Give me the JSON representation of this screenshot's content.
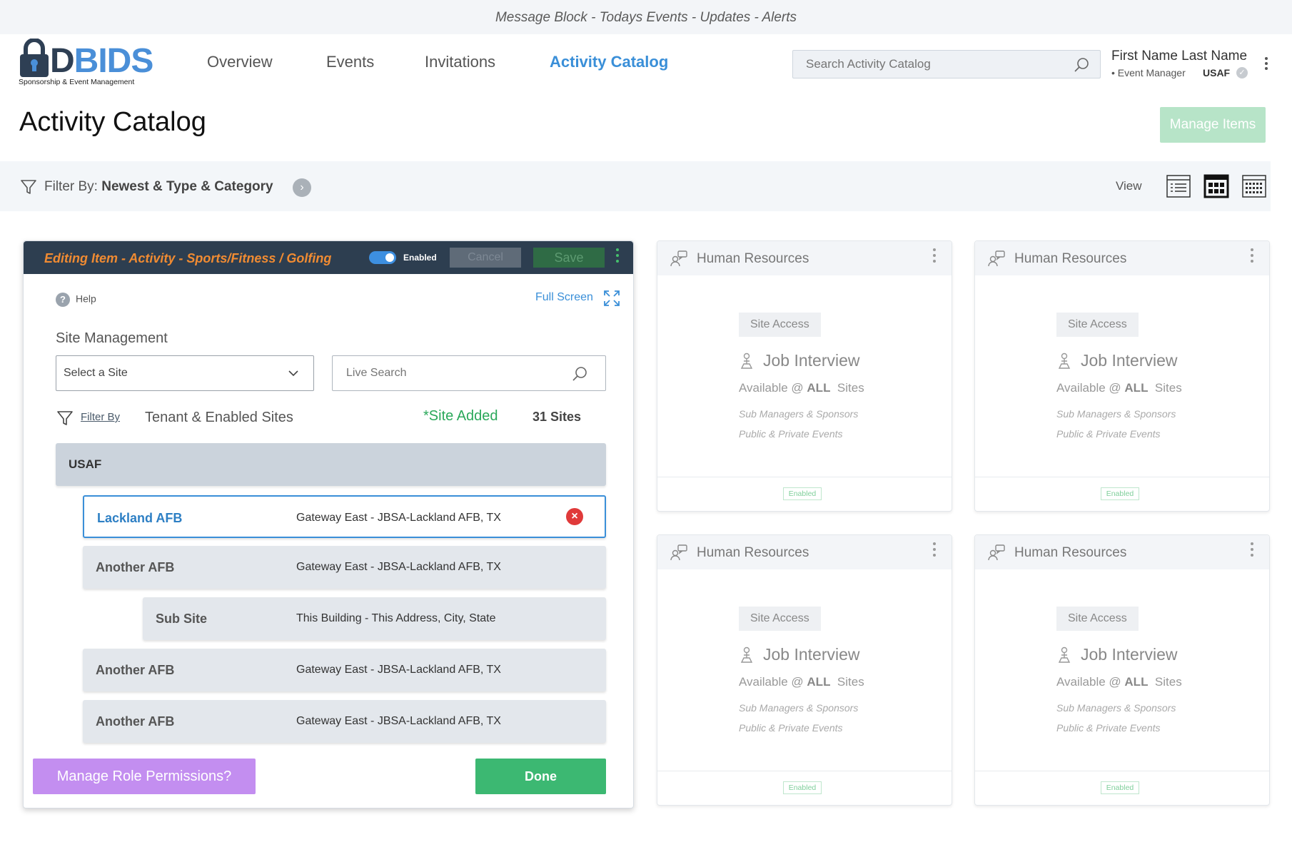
{
  "message_bar": "Message Block - Todays Events - Updates - Alerts",
  "logo": {
    "prefix": "D",
    "brand": "BIDS",
    "tagline": "Sponsorship & Event Management"
  },
  "nav": [
    {
      "label": "Overview",
      "active": false
    },
    {
      "label": "Events",
      "active": false
    },
    {
      "label": "Invitations",
      "active": false
    },
    {
      "label": "Activity Catalog",
      "active": true
    }
  ],
  "search": {
    "placeholder": "Search Activity Catalog"
  },
  "user": {
    "name": "First Name Last Name",
    "role": "• Event Manager",
    "org": "USAF"
  },
  "page_title": "Activity Catalog",
  "manage_items_label": "Manage Items",
  "filter": {
    "label": "Filter By:",
    "value": "Newest & Type & Category"
  },
  "view_label": "View",
  "editor": {
    "title": "Editing Item - Activity - Sports/Fitness / Golfing",
    "toggle_label": "Enabled",
    "enabled": true,
    "cancel_label": "Cancel",
    "save_label": "Save",
    "help_label": "Help",
    "fullscreen_label": "Full Screen",
    "section_title": "Site Management",
    "select_site": "Select a Site",
    "live_search_placeholder": "Live Search",
    "filter_by_label": "Filter By",
    "filter_value": "Tenant & Enabled Sites",
    "site_added": "*Site Added",
    "site_count": "31 Sites",
    "group": "USAF",
    "sites": [
      {
        "name": "Lackland AFB",
        "address": "Gateway East - JBSA-Lackland AFB, TX",
        "selected": true
      },
      {
        "name": "Another  AFB",
        "address": "Gateway East - JBSA-Lackland AFB, TX",
        "selected": false
      },
      {
        "name": "Sub Site",
        "address": "This Building - This Address, City, State",
        "selected": false
      },
      {
        "name": "Another  AFB",
        "address": "Gateway East - JBSA-Lackland AFB, TX",
        "selected": false
      },
      {
        "name": "Another  AFB",
        "address": "Gateway East - JBSA-Lackland AFB, TX",
        "selected": false
      }
    ],
    "role_permissions_label": "Manage Role Permissions?",
    "done_label": "Done"
  },
  "cards": [
    {
      "title": "Human Resources",
      "badge": "Site Access",
      "job": "Job Interview",
      "avail_pre": "Available @",
      "avail_bold": "ALL",
      "avail_post": "Sites",
      "sub1": "Sub Managers & Sponsors",
      "sub2": "Public & Private Events",
      "status": "Enabled"
    },
    {
      "title": "Human Resources",
      "badge": "Site Access",
      "job": "Job Interview",
      "avail_pre": "Available @",
      "avail_bold": "ALL",
      "avail_post": "Sites",
      "sub1": "Sub Managers & Sponsors",
      "sub2": "Public & Private Events",
      "status": "Enabled"
    },
    {
      "title": "Human Resources",
      "badge": "Site Access",
      "job": "Job Interview",
      "avail_pre": "Available @",
      "avail_bold": "ALL",
      "avail_post": "Sites",
      "sub1": "Sub Managers & Sponsors",
      "sub2": "Public & Private Events",
      "status": "Enabled"
    },
    {
      "title": "Human Resources",
      "badge": "Site Access",
      "job": "Job Interview",
      "avail_pre": "Available @",
      "avail_bold": "ALL",
      "avail_post": "Sites",
      "sub1": "Sub Managers & Sponsors",
      "sub2": "Public & Private Events",
      "status": "Enabled"
    }
  ],
  "colors": {
    "accent_blue": "#3a8fd8",
    "header_dark": "#2d3e50",
    "title_orange": "#f08b32",
    "success_green": "#3cb872",
    "role_purple": "#c38ef0",
    "remove_red": "#e03a3a"
  },
  "icons": {
    "search": "search-icon",
    "filter": "filter-icon",
    "lock": "lock-icon",
    "list_view": "list-view-icon",
    "grid_view": "grid-view-icon",
    "calendar_view": "calendar-view-icon",
    "help": "help-icon",
    "fullscreen": "fullscreen-icon",
    "chevron": "chevron-down-icon",
    "remove": "remove-icon",
    "card": "chat-user-icon",
    "job": "person-icon",
    "more": "kebab-icon"
  }
}
